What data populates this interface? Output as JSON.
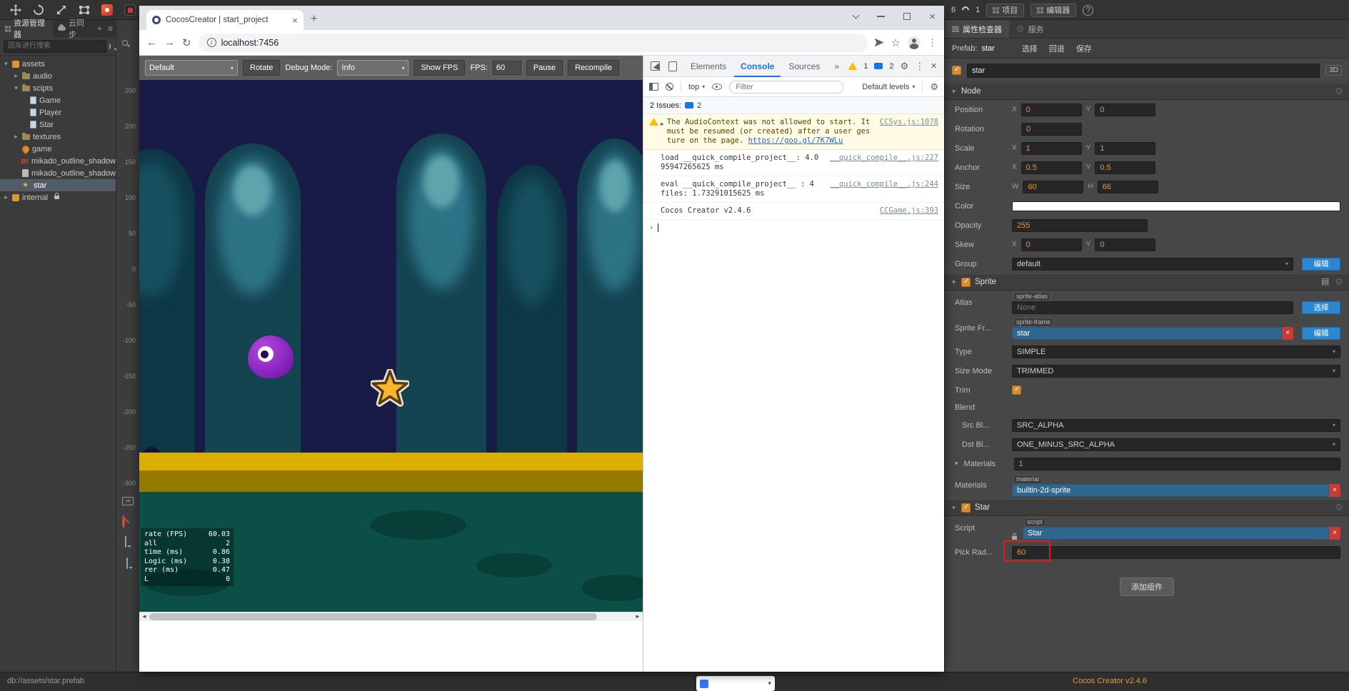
{
  "colors": {
    "accent_orange": "#e8973c",
    "button_blue": "#2b87d1",
    "field_blue": "#31668e",
    "delete_red": "#c73b35",
    "annotation_red": "#e01b1b",
    "devtools_blue": "#1a73e8",
    "warning_bg": "#fffbe5",
    "selection_bg": "#515c68",
    "scene": {
      "sky": "#191b47",
      "ghost_dark": "#0d3745",
      "ghost_teal": "#144351",
      "ghost_highlight": "#2d7386",
      "gold_stripe": "#dcae00",
      "ground": "#0b4f46",
      "star": "#f7b42c",
      "character": "#9b2fd6"
    }
  },
  "titlebar": {
    "net_left": "6",
    "net_right": "1",
    "project_button": "项目",
    "editor_button": "编辑器",
    "help": "?"
  },
  "assets_panel": {
    "tab_assets": "资源管理器",
    "tab_sync": "云同步",
    "add_icon": "+",
    "menu_icon": "≡",
    "search_placeholder": "回车进行搜索",
    "tree": [
      {
        "label": "assets",
        "icon": "asset-box",
        "expanded": true
      },
      {
        "label": "audio",
        "icon": "folder",
        "expanded": false
      },
      {
        "label": "scipts",
        "icon": "folder",
        "expanded": true
      },
      {
        "label": "Game",
        "icon": "script"
      },
      {
        "label": "Player",
        "icon": "script"
      },
      {
        "label": "Star",
        "icon": "script"
      },
      {
        "label": "textures",
        "icon": "folder",
        "expanded": false
      },
      {
        "label": "game",
        "icon": "scene"
      },
      {
        "label": "mikado_outline_shadow",
        "icon": "bitmap-font"
      },
      {
        "label": "mikado_outline_shadow",
        "icon": "file"
      },
      {
        "label": "star",
        "icon": "prefab",
        "selected": true
      },
      {
        "label": "internal",
        "icon": "asset-box",
        "locked": true,
        "expanded": false
      }
    ],
    "status_path": "db://assets/star.prefab"
  },
  "ruler": {
    "labels": [
      "250",
      "200",
      "150",
      "100",
      "50",
      "0",
      "-50",
      "-100",
      "-150",
      "-200",
      "-250",
      "-300"
    ]
  },
  "browser": {
    "tab_title": "CocosCreator | start_project",
    "url": "localhost:7456"
  },
  "game_toolbar": {
    "scene_select": "Default",
    "rotate": "Rotate",
    "debug_label": "Debug Mode:",
    "debug_select": "Info",
    "show_fps": "Show FPS",
    "fps_label": "FPS:",
    "fps_value": "60",
    "pause": "Pause",
    "recompile": "Recompile"
  },
  "stats": [
    {
      "label": "rate (FPS)",
      "value": "60.03"
    },
    {
      "label": "all",
      "value": "2"
    },
    {
      "label": "time (ms)",
      "value": "0.86"
    },
    {
      "label": "Logic (ms)",
      "value": "0.38"
    },
    {
      "label": "rer (ms)",
      "value": "0.47"
    },
    {
      "label": "L",
      "value": "0"
    }
  ],
  "devtools": {
    "tabs": {
      "elements": "Elements",
      "console": "Console",
      "sources": "Sources",
      "more": "»"
    },
    "warn_count": "1",
    "msg_count": "2",
    "context": "top",
    "filter_placeholder": "Filter",
    "levels": "Default levels",
    "issues_label": "2 Issues:",
    "issues_count": "2",
    "console": [
      {
        "type": "warning",
        "text": "The AudioContext was not allowed to start. It must be resumed (or created) after a user gesture on the page. ",
        "link": "https://goo.gl/7K7WLu",
        "source": "CCSys.js:1078"
      },
      {
        "type": "log",
        "text": "load __quick_compile_project__: 4.095947265625 ms",
        "source": "__quick_compile__.js:227"
      },
      {
        "type": "log",
        "text": "eval __quick_compile_project__ : 4 files: 1.73291015625 ms",
        "source": "__quick_compile__.js:244"
      },
      {
        "type": "log",
        "text": "Cocos Creator v2.4.6",
        "source": "CCGame.js:393"
      }
    ]
  },
  "inspector": {
    "tab_properties": "属性检查器",
    "tab_services": "服务",
    "prefab_label": "Prefab:",
    "prefab_name": "star",
    "action_select": "选择",
    "action_revert": "回退",
    "action_save": "保存",
    "node_name": "star",
    "mode_3d": "3D",
    "axes": {
      "x": "X",
      "y": "Y",
      "w": "W",
      "h": "H"
    },
    "node": {
      "title": "Node",
      "position_label": "Position",
      "position_x": "0",
      "position_y": "0",
      "rotation_label": "Rotation",
      "rotation": "0",
      "scale_label": "Scale",
      "scale_x": "1",
      "scale_y": "1",
      "anchor_label": "Anchor",
      "anchor_x": "0.5",
      "anchor_y": "0.5",
      "size_label": "Size",
      "size_w": "60",
      "size_h": "66",
      "color_label": "Color",
      "opacity_label": "Opacity",
      "opacity": "255",
      "skew_label": "Skew",
      "skew_x": "0",
      "skew_y": "0",
      "group_label": "Group",
      "group_value": "default",
      "group_edit": "编辑"
    },
    "sprite": {
      "title": "Sprite",
      "atlas_label": "Atlas",
      "atlas_badge": "sprite-atlas",
      "atlas_value": "None",
      "atlas_action": "选择",
      "frame_label": "Sprite Fr...",
      "frame_badge": "sprite-frame",
      "frame_value": "star",
      "frame_action": "编辑",
      "type_label": "Type",
      "type_value": "SIMPLE",
      "sizemode_label": "Size Mode",
      "sizemode_value": "TRIMMED",
      "trim_label": "Trim",
      "blend_label": "Blend",
      "src_label": "Src Bl...",
      "src_value": "SRC_ALPHA",
      "dst_label": "Dst Bl...",
      "dst_value": "ONE_MINUS_SRC_ALPHA",
      "materials_count_label": "Materials",
      "materials_count": "1",
      "materials_label": "Materials",
      "materials_badge": "material",
      "materials_value": "builtin-2d-sprite"
    },
    "star": {
      "title": "Star",
      "script_label": "Script",
      "script_badge": "script",
      "script_value": "Star",
      "pick_label": "Pick Rad...",
      "pick_value": "60"
    },
    "add_component": "添加组件",
    "version": "Cocos Creator v2.4.6"
  }
}
